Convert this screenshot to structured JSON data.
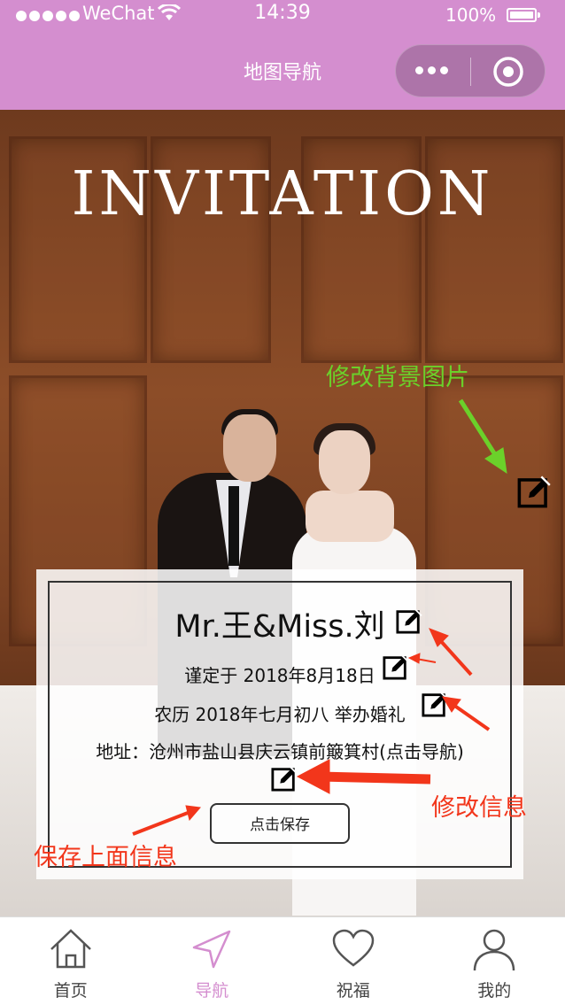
{
  "status_bar": {
    "carrier": "WeChat",
    "time": "14:39",
    "battery": "100%"
  },
  "nav": {
    "title": "地图导航"
  },
  "photo": {
    "heading": "INVITATION"
  },
  "annotations": {
    "change_background": "修改背景图片",
    "edit_info": "修改信息",
    "save_info": "保存上面信息"
  },
  "card": {
    "names": "Mr.王&Miss.刘",
    "date_line": "谨定于 2018年8月18日",
    "lunar_line": "农历 2018年七月初八 举办婚礼",
    "address_line": "地址：沧州市盐山县庆云镇前簸箕村(点击导航)",
    "save_button": "点击保存"
  },
  "tabbar": {
    "items": [
      {
        "label": "首页",
        "icon": "home-icon",
        "active": false
      },
      {
        "label": "导航",
        "icon": "navigation-icon",
        "active": true
      },
      {
        "label": "祝福",
        "icon": "heart-icon",
        "active": false
      },
      {
        "label": "我的",
        "icon": "user-icon",
        "active": false
      }
    ]
  },
  "colors": {
    "header": "#d48ecf",
    "active_tab": "#d48ecf",
    "annotation_green": "#6bd12a",
    "annotation_red": "#f2361b"
  }
}
